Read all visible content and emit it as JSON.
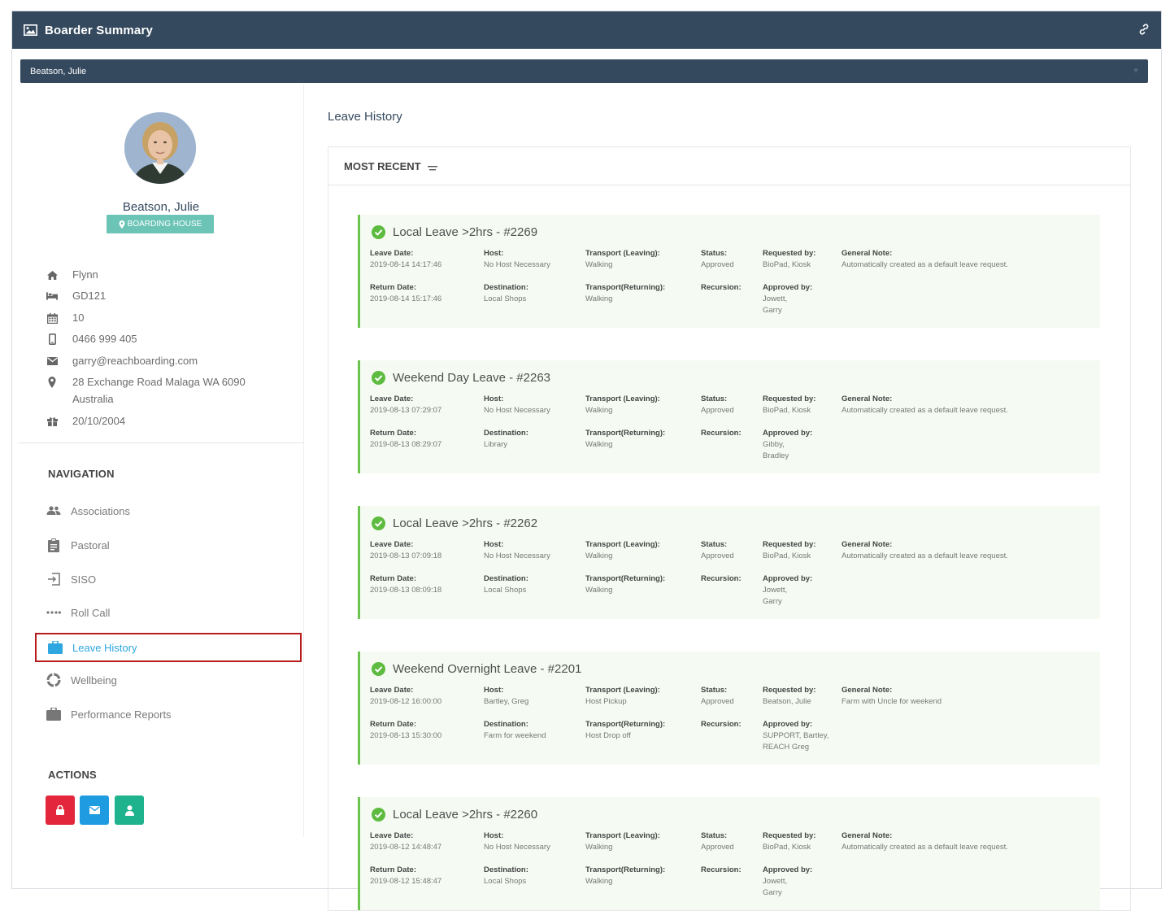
{
  "header": {
    "title": "Boarder Summary",
    "image_icon": "image-icon",
    "link_icon": "link-icon"
  },
  "student_select": {
    "value": "Beatson, Julie"
  },
  "profile": {
    "name": "Beatson, Julie",
    "badge": "BOARDING HOUSE",
    "house": "Flynn",
    "room": "GD121",
    "year": "10",
    "phone": "0466 999 405",
    "email": "garry@reachboarding.com",
    "address_line1": "28 Exchange Road Malaga WA 6090",
    "address_line2": "Australia",
    "dob": "20/10/2004"
  },
  "navigation": {
    "title": "NAVIGATION",
    "items": [
      {
        "label": "Associations",
        "icon": "users-icon"
      },
      {
        "label": "Pastoral",
        "icon": "clipboard-icon"
      },
      {
        "label": "SISO",
        "icon": "sign-in-icon"
      },
      {
        "label": "Roll Call",
        "icon": "ellipsis-icon"
      },
      {
        "label": "Leave History",
        "icon": "briefcase-icon",
        "active": true
      },
      {
        "label": "Wellbeing",
        "icon": "ring-icon"
      },
      {
        "label": "Performance Reports",
        "icon": "briefcase-icon"
      }
    ]
  },
  "actions": {
    "title": "ACTIONS",
    "buttons": [
      {
        "icon": "lock-icon",
        "color": "#e3263b"
      },
      {
        "icon": "envelope-icon",
        "color": "#1e9be1"
      },
      {
        "icon": "user-icon",
        "color": "#1fb38d"
      }
    ]
  },
  "main": {
    "title": "Leave History",
    "sort_label": "MOST RECENT"
  },
  "labels": {
    "leave_date": "Leave Date:",
    "return_date": "Return Date:",
    "host": "Host:",
    "destination": "Destination:",
    "transport_leaving": "Transport (Leaving):",
    "transport_returning": "Transport(Returning):",
    "status": "Status:",
    "recursion": "Recursion:",
    "requested_by": "Requested by:",
    "approved_by": "Approved by:",
    "general_note": "General Note:"
  },
  "leaves": [
    {
      "title": "Local Leave >2hrs - #2269",
      "leave_date": "2019-08-14 14:17:46",
      "return_date": "2019-08-14 15:17:46",
      "host": "No Host Necessary",
      "destination": "Local Shops",
      "transport_leaving": "Walking",
      "transport_returning": "Walking",
      "status": "Approved",
      "recursion": "",
      "requested_by": "BioPad, Kiosk",
      "approved_by_1": "Jowett,",
      "approved_by_2": "Garry",
      "general_note": "Automatically created as a default leave request."
    },
    {
      "title": "Weekend Day Leave - #2263",
      "leave_date": "2019-08-13 07:29:07",
      "return_date": "2019-08-13 08:29:07",
      "host": "No Host Necessary",
      "destination": "Library",
      "transport_leaving": "Walking",
      "transport_returning": "Walking",
      "status": "Approved",
      "recursion": "",
      "requested_by": "BioPad, Kiosk",
      "approved_by_1": "Gibby,",
      "approved_by_2": "Bradley",
      "general_note": "Automatically created as a default leave request."
    },
    {
      "title": "Local Leave >2hrs - #2262",
      "leave_date": "2019-08-13 07:09:18",
      "return_date": "2019-08-13 08:09:18",
      "host": "No Host Necessary",
      "destination": "Local Shops",
      "transport_leaving": "Walking",
      "transport_returning": "Walking",
      "status": "Approved",
      "recursion": "",
      "requested_by": "BioPad, Kiosk",
      "approved_by_1": "Jowett,",
      "approved_by_2": "Garry",
      "general_note": "Automatically created as a default leave request."
    },
    {
      "title": "Weekend Overnight Leave - #2201",
      "leave_date": "2019-08-12 16:00:00",
      "return_date": "2019-08-13 15:30:00",
      "host": "Bartley, Greg",
      "destination": "Farm for weekend",
      "transport_leaving": "Host Pickup",
      "transport_returning": "Host Drop off",
      "status": "Approved",
      "recursion": "",
      "requested_by": "Beatson, Julie",
      "approved_by_1": "SUPPORT, Bartley,",
      "approved_by_2": "REACH Greg",
      "general_note": "Farm with Uncle for weekend"
    },
    {
      "title": "Local Leave >2hrs - #2260",
      "leave_date": "2019-08-12 14:48:47",
      "return_date": "2019-08-12 15:48:47",
      "host": "No Host Necessary",
      "destination": "Local Shops",
      "transport_leaving": "Walking",
      "transport_returning": "Walking",
      "status": "Approved",
      "recursion": "",
      "requested_by": "BioPad, Kiosk",
      "approved_by_1": "Jowett,",
      "approved_by_2": "Garry",
      "general_note": "Automatically created as a default leave request."
    }
  ]
}
